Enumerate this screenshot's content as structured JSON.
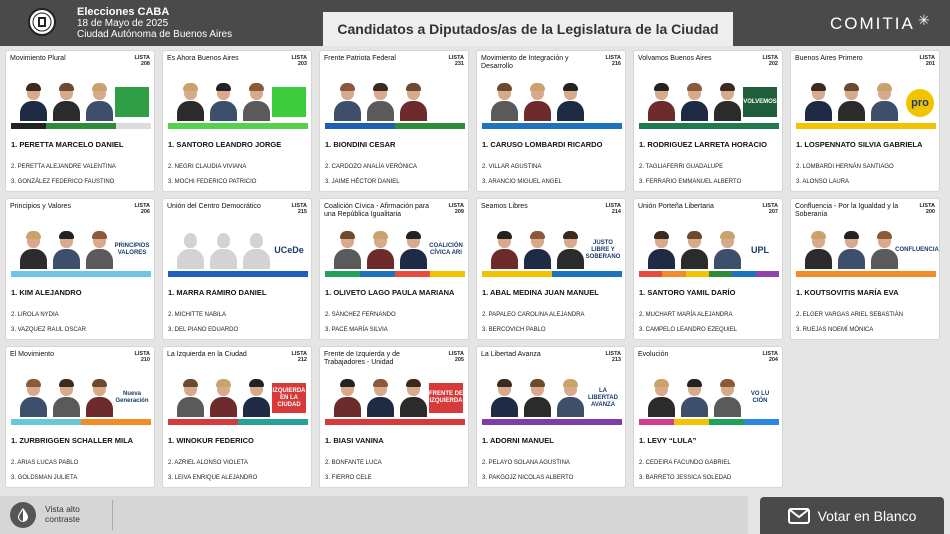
{
  "header": {
    "line1": "Elecciones CABA",
    "line2": "18 de Mayo de 2025",
    "line3": "Ciudad Autónoma de Buenos Aires",
    "title": "Candidatos a Diputados/as de la Legislatura de la Ciudad",
    "brand": "COMITIA",
    "brand_mark": "✳"
  },
  "lista_label": "LISTA",
  "cards": [
    {
      "party": "Movimiento Plural",
      "lista": "208",
      "c1": "1. PERETTA MARCELO DANIEL",
      "c2": "2. PERETTA ALEJANDRE VALENTINA",
      "c3": "3. GONZÁLEZ FEDERICO FAUSTINO",
      "stripe": [
        "#222222",
        "#2e8b3a",
        "#2e8b3a",
        "#dcdcdc"
      ],
      "logo_text": "",
      "logo_bg": "#2f9e44"
    },
    {
      "party": "Es Ahora Buenos Aires",
      "lista": "203",
      "c1": "1. SANTORO LEANDRO JORGE",
      "c2": "2. NEGRI CLAUDIA VIVIANA",
      "c3": "3. MOCHI FEDERICO PATRICIO",
      "stripe": [
        "#55d14a"
      ],
      "logo_text": "",
      "logo_bg": "#3dcc3d"
    },
    {
      "party": "Frente Patriota Federal",
      "lista": "231",
      "c1": "1. BIONDINI CESAR",
      "c2": "2. CARDOZO ANALÍA VERÓNICA",
      "c3": "3. JAIME HÉCTOR DANIEL",
      "stripe": [
        "#1e5fb3",
        "#2e8b3a"
      ],
      "logo_text": "",
      "logo_bg": "#ffffff"
    },
    {
      "party": "Movimiento de Integración y Desarrollo",
      "lista": "216",
      "c1": "1. CARUSO LOMBARDI RICARDO",
      "c2": "2. VILLAR AGUSTINA",
      "c3": "3. ARANCIO MIGUEL ANGEL",
      "stripe": [
        "#1e73be"
      ],
      "logo_text": "",
      "logo_bg": "#ffffff"
    },
    {
      "party": "Volvamos Buenos Aires",
      "lista": "202",
      "c1": "1. RODRIGUEZ LARRETA HORACIO",
      "c2": "2. TAGLIAFERRI GUADALUPE",
      "c3": "3. FERRARIO EMMANUEL ALBERTO",
      "stripe": [
        "#1f7a4d"
      ],
      "logo_text": "VOLVEMOS",
      "logo_bg": "#1f5e3a"
    },
    {
      "party": "Buenos Aires Primero",
      "lista": "201",
      "c1": "1. LOSPENNATO SILVIA GABRIELA",
      "c2": "2. LOMBARDI HERNÁN SANTIAGO",
      "c3": "3. ALONSO LAURA",
      "stripe": [
        "#f2c400"
      ],
      "logo_text": "pro",
      "logo_bg": "#f2c400"
    },
    {
      "party": "Principios y Valores",
      "lista": "206",
      "c1": "1. KIM ALEJANDRO",
      "c2": "2. LIROLA NYDIA",
      "c3": "3. VAZQUEZ RAUL OSCAR",
      "stripe": [
        "#6ec6e6"
      ],
      "logo_text": "PRINCIPIOS VALORES",
      "logo_bg": "#ffffff"
    },
    {
      "party": "Unión del Centro Democrático",
      "lista": "215",
      "c1": "1. MARRA RAMIRO DANIEL",
      "c2": "2. MICHITTE NABILA",
      "c3": "3. DEL PIANO EDUARDO",
      "stripe": [
        "#1f5fbf"
      ],
      "logo_text": "UCeDe",
      "logo_bg": "#ffffff"
    },
    {
      "party": "Coalición Cívica - Afirmación para una República Igualitaria",
      "lista": "209",
      "c1": "1. OLIVETO LAGO PAULA MARIANA",
      "c2": "2. SÁNCHEZ FERNANDO",
      "c3": "3. PACE MARÍA SILVIA",
      "stripe": [
        "#1fa35c",
        "#1e73be",
        "#e74c3c",
        "#f2c400"
      ],
      "logo_text": "COALICIÓN CÍVICA ARI",
      "logo_bg": "#ffffff"
    },
    {
      "party": "Seamos Libres",
      "lista": "214",
      "c1": "1. ABAL MEDINA JUAN MANUEL",
      "c2": "2. PAPALEO CAROLINA ALEJANDRA",
      "c3": "3. BERCOVICH PABLO",
      "stripe": [
        "#f2c400",
        "#1e73be"
      ],
      "logo_text": "JUSTO LIBRE Y SOBERANO",
      "logo_bg": "#ffffff"
    },
    {
      "party": "Unión Porteña Libertaria",
      "lista": "207",
      "c1": "1. SANTORO YAMIL DARÍO",
      "c2": "2. MUCHART MARÍA ALEJANDRA",
      "c3": "3. CAMPELO LEANDRO EZEQUIEL",
      "stripe": [
        "#e74c3c",
        "#f28c28",
        "#f2c400",
        "#2e8b3a",
        "#1e73be",
        "#8e44ad"
      ],
      "logo_text": "UPL",
      "logo_bg": "#ffffff"
    },
    {
      "party": "Confluencia - Por la Igualdad y la Soberanía",
      "lista": "200",
      "c1": "1. KOUTSOVITIS MARÍA EVA",
      "c2": "2. ELGER VARGAS ARIEL SEBASTIÁN",
      "c3": "3. RUEJAS NOEMÍ MÓNICA",
      "stripe": [
        "#f28c28"
      ],
      "logo_text": "CONFLUENCIA",
      "logo_bg": "#ffffff"
    },
    {
      "party": "El Movimiento",
      "lista": "210",
      "c1": "1. ZURBRIGGEN SCHALLER MILA",
      "c2": "2. ARIAS LUCAS PABLO",
      "c3": "3. GOLDSMAN JULIETA",
      "stripe": [
        "#67c8d6",
        "#f28c28"
      ],
      "logo_text": "Nueva Generación",
      "logo_bg": "#ffffff"
    },
    {
      "party": "La Izquierda en la Ciudad",
      "lista": "212",
      "c1": "1. WINOKUR FEDERICO",
      "c2": "2. AZRIEL ALONSO VIOLETA",
      "c3": "3. LEIVA ENRIQUE ALEJANDRO",
      "stripe": [
        "#d63a3a",
        "#2aa198"
      ],
      "logo_text": "IZQUIERDA EN LA CIUDAD",
      "logo_bg": "#d63a3a"
    },
    {
      "party": "Frente de Izquierda y de Trabajadores - Unidad",
      "lista": "205",
      "c1": "1. BIASI VANINA",
      "c2": "2. BONFANTE LUCA",
      "c3": "3. FIERRO CELE",
      "stripe": [
        "#d63a3a"
      ],
      "logo_text": "FRENTE DE IZQUIERDA",
      "logo_bg": "#d63a3a"
    },
    {
      "party": "La Libertad Avanza",
      "lista": "213",
      "c1": "1. ADORNI MANUEL",
      "c2": "2. PELAYO SOLANA AGUSTINA",
      "c3": "3. PAKGOJZ NICOLAS ALBERTO",
      "stripe": [
        "#7b3fa6"
      ],
      "logo_text": "LA LIBERTAD AVANZA",
      "logo_bg": "#ffffff"
    },
    {
      "party": "Evolución",
      "lista": "204",
      "c1": "1. LEVY “LULA”",
      "c2": "2. CEDEIRA FACUNDO GABRIEL",
      "c3": "3. BARRETO JESSICA SOLEDAD",
      "stripe": [
        "#d63a8a",
        "#f2c400",
        "#1fa35c",
        "#2e86de"
      ],
      "logo_text": "VO LU CIÓN",
      "logo_bg": "#ffffff"
    }
  ],
  "footer": {
    "contrast_label": "Vista alto contraste",
    "blank_vote": "Votar en Blanco"
  },
  "colors": {
    "header_bg": "#4a4a4a",
    "page_bg": "#e5e5e5"
  }
}
